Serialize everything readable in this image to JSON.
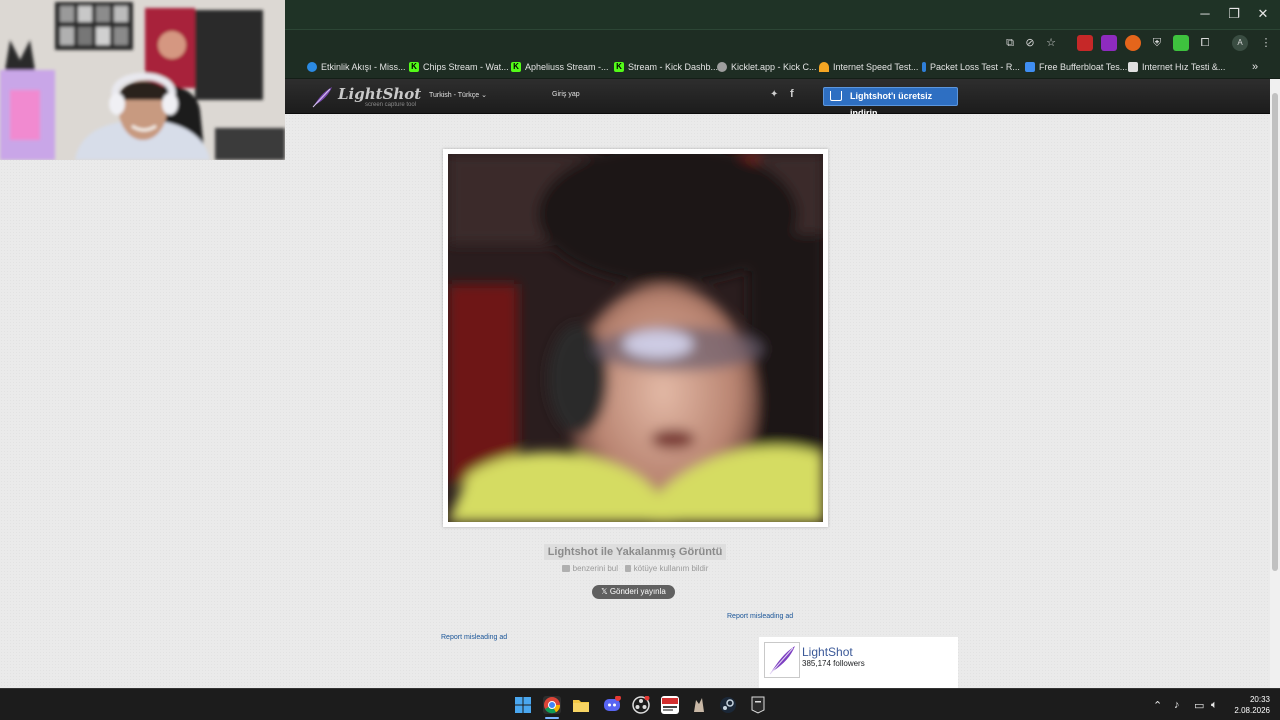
{
  "bookmarks": [
    {
      "label": "Etkinlik Akışı - Miss...",
      "icon": "globe-icon",
      "color": "#2b8ae2"
    },
    {
      "label": "Chips Stream - Wat...",
      "icon": "kick-icon",
      "color": "#53fc18"
    },
    {
      "label": "Apheliuss Stream -...",
      "icon": "kick-icon",
      "color": "#53fc18"
    },
    {
      "label": "Stream - Kick Dashb...",
      "icon": "kick-icon",
      "color": "#53fc18"
    },
    {
      "label": "Kicklet.app - Kick C...",
      "icon": "kicklet-icon",
      "color": "#9e9e9e"
    },
    {
      "label": "Internet Speed Test...",
      "icon": "speedtest-icon",
      "color": "#f5a623"
    },
    {
      "label": "Packet Loss Test - R...",
      "icon": "packetloss-icon",
      "color": "#2f7fd8"
    },
    {
      "label": "Free Bufferbloat Tes...",
      "icon": "bolt-icon",
      "color": "#3f8ef2"
    },
    {
      "label": "Internet Hız Testi &...",
      "icon": "page-icon",
      "color": "#e0e0e0"
    }
  ],
  "header": {
    "logo_name": "LightShot",
    "logo_tagline": "screen capture tool",
    "language": "Turkish - Türkçe ⌄",
    "login": "Giriş yap",
    "twitter_glyph": "🐦",
    "facebook_glyph": "f",
    "download_label": "Lightshot'ı ücretsiz indirin"
  },
  "screenshot": {
    "caption": "Lightshot ile Yakalanmış Görüntü",
    "find_similar": "benzerini bul",
    "report_abuse": "kötüye kullanım bildir",
    "tweet_label": "Gönderi yayınla"
  },
  "ads": {
    "report_right": "Report misleading ad",
    "report_left": "Report misleading ad"
  },
  "facebook": {
    "page_name": "LightShot",
    "followers": "385,174 followers"
  },
  "clock": {
    "time": "20:33",
    "date": "2.08.2026"
  }
}
